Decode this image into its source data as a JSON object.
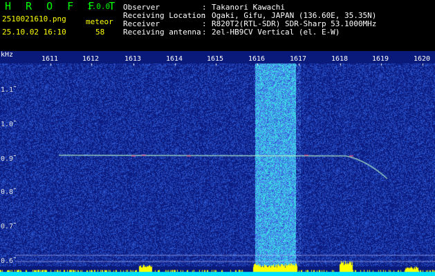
{
  "header": {
    "brand": "H R O F F T",
    "version": "1.0.0",
    "filename": "2510021610.png",
    "timestamp": "25.10.02 16:10",
    "meteor_label": "meteor",
    "meteor_count": "58"
  },
  "info": [
    {
      "key": "Observer",
      "sep": ":",
      "value": "Takanori Kawachi"
    },
    {
      "key": "Receiving Location",
      "sep": ":",
      "value": "Ogaki, Gifu, JAPAN (136.60E, 35.35N)"
    },
    {
      "key": "Receiver",
      "sep": ":",
      "value": "R820T2(RTL-SDR) SDR-Sharp 53.1000MHz"
    },
    {
      "key": "Receiving antenna",
      "sep": ":",
      "value": "2el-HB9CV Vertical (el. E-W)"
    }
  ],
  "spectrogram": {
    "y_unit": "kHz",
    "y_ticks": [
      "1.1",
      "1.0",
      "0.9",
      "0.8",
      "0.7",
      "0.6"
    ],
    "x_ticks": [
      "1611",
      "1612",
      "1613",
      "1614",
      "1615",
      "1616",
      "1617",
      "1618",
      "1619",
      "1620"
    ],
    "colors": {
      "background": "#0a1a7a",
      "noise": "#3a6ad8",
      "hot": "#00ffff",
      "level": "#ffff00",
      "floor": "#00e0ff"
    }
  }
}
